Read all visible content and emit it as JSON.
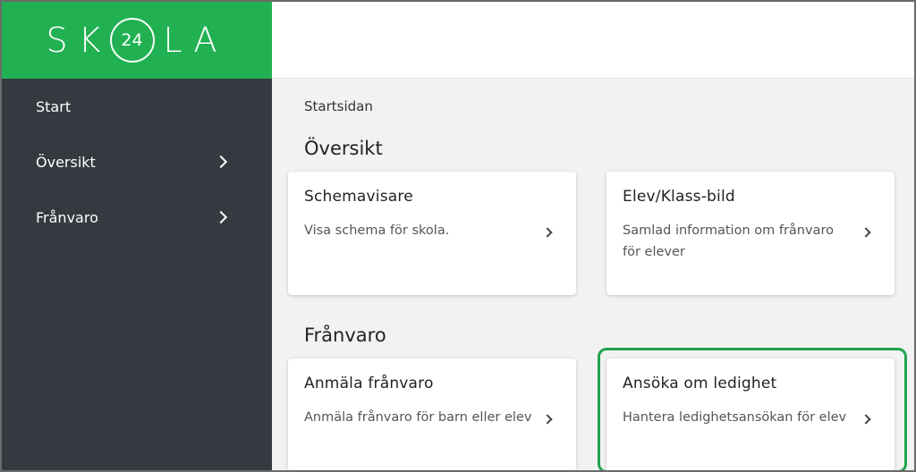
{
  "brand": {
    "logo_left": "SK",
    "logo_num": "24",
    "logo_right": "LA",
    "color": "#21b152"
  },
  "sidebar": {
    "items": [
      {
        "label": "Start",
        "has_chevron": false
      },
      {
        "label": "Översikt",
        "has_chevron": true
      },
      {
        "label": "Frånvaro",
        "has_chevron": true
      }
    ]
  },
  "main": {
    "breadcrumb": "Startsidan",
    "sections": [
      {
        "title": "Översikt",
        "cards": [
          {
            "title": "Schemavisare",
            "desc": "Visa schema för skola."
          },
          {
            "title": "Elev/Klass-bild",
            "desc": "Samlad information om frånvaro för elever"
          }
        ]
      },
      {
        "title": "Frånvaro",
        "cards": [
          {
            "title": "Anmäla frånvaro",
            "desc": "Anmäla frånvaro för barn eller elev"
          },
          {
            "title": "Ansöka om ledighet",
            "desc": "Hantera ledighetsansökan för elev"
          }
        ]
      }
    ]
  },
  "highlight_color": "#21a34f"
}
